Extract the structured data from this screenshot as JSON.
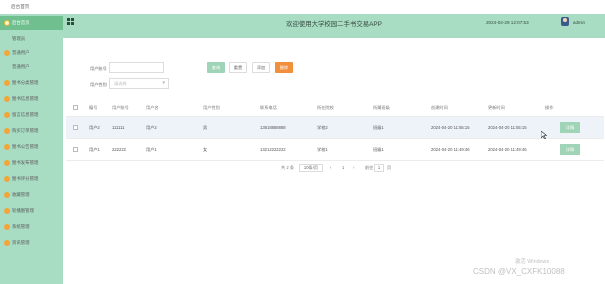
{
  "topstrip": {
    "home": "后台首页"
  },
  "sidebar": {
    "items": [
      {
        "label": "后台首页",
        "active": true
      },
      {
        "label": "管理员",
        "sub": true
      },
      {
        "label": "普通用户",
        "header": true
      },
      {
        "label": "普通用户",
        "sub": true
      },
      {
        "label": "图书分类管理"
      },
      {
        "label": "图书信息管理"
      },
      {
        "label": "留言信息管理"
      },
      {
        "label": "购买订单管理"
      },
      {
        "label": "图书公告管理"
      },
      {
        "label": "图书发布管理"
      },
      {
        "label": "图书评分管理"
      },
      {
        "label": "收藏管理"
      },
      {
        "label": "轮播图管理"
      },
      {
        "label": "系统管理"
      },
      {
        "label": "资讯管理"
      }
    ]
  },
  "header": {
    "title": "欢迎使用大学校园二手书交易APP",
    "datetime": "2024-04-29 12:07:53",
    "username": "admin"
  },
  "filters": {
    "field1_label": "用户账号",
    "field1_value": "",
    "field2_label": "用户性别",
    "field2_placeholder": "请选择",
    "search_label": "查询",
    "reset_label": "重置",
    "add_label": "添加",
    "delete_label": "删除"
  },
  "table": {
    "columns": [
      "",
      "编号",
      "用户账号",
      "用户名",
      "用户性别",
      "联系电话",
      "所在院校",
      "所属班级",
      "创建时间",
      "更新时间",
      "操作"
    ],
    "rows": [
      {
        "cells": [
          "",
          "用户2",
          "111111",
          "用户2",
          "男",
          "13818888888",
          "学校2",
          "班级1",
          "2024-04-20 11:55:15",
          "2024-04-20 11:55:15"
        ],
        "action": "详情"
      },
      {
        "cells": [
          "",
          "用户1",
          "222222",
          "用户1",
          "女",
          "13212222222",
          "学校1",
          "班级1",
          "2024-04-20 11:49:46",
          "2024-04-20 11:49:46"
        ],
        "action": "详情"
      }
    ]
  },
  "pagination": {
    "total": "共 2 条",
    "page_size": "10条/页",
    "prev": "‹",
    "page": "1",
    "next": "›",
    "goto_label": "前往",
    "goto_value": "1",
    "page_unit": "页"
  },
  "watermark": {
    "activate": "激活 Windows",
    "csdn": "CSDN @VX_CXFK10088"
  },
  "colors": {
    "sidebar": "#a8ddc4",
    "active": "#6fbf8f",
    "accent_button": "#9fd4b6",
    "delete_button": "#f28f3b"
  }
}
